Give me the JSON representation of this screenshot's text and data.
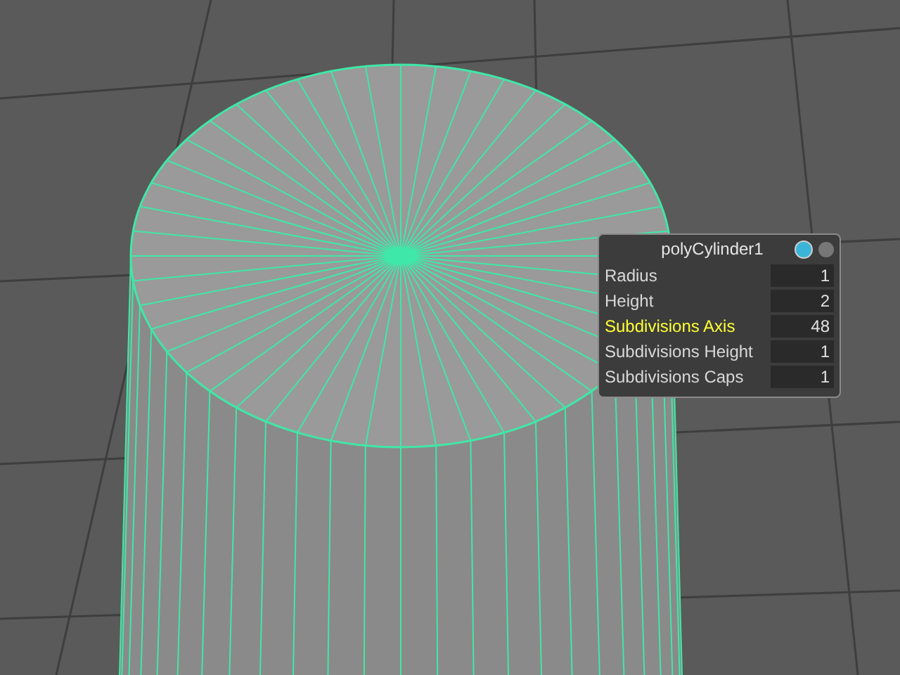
{
  "node_panel": {
    "title": "polyCylinder1",
    "attributes": [
      {
        "name": "Radius",
        "value": "1",
        "selected": false
      },
      {
        "name": "Height",
        "value": "2",
        "selected": false
      },
      {
        "name": "Subdivisions Axis",
        "value": "48",
        "selected": true
      },
      {
        "name": "Subdivisions Height",
        "value": "1",
        "selected": false
      },
      {
        "name": "Subdivisions Caps",
        "value": "1",
        "selected": false
      }
    ]
  }
}
